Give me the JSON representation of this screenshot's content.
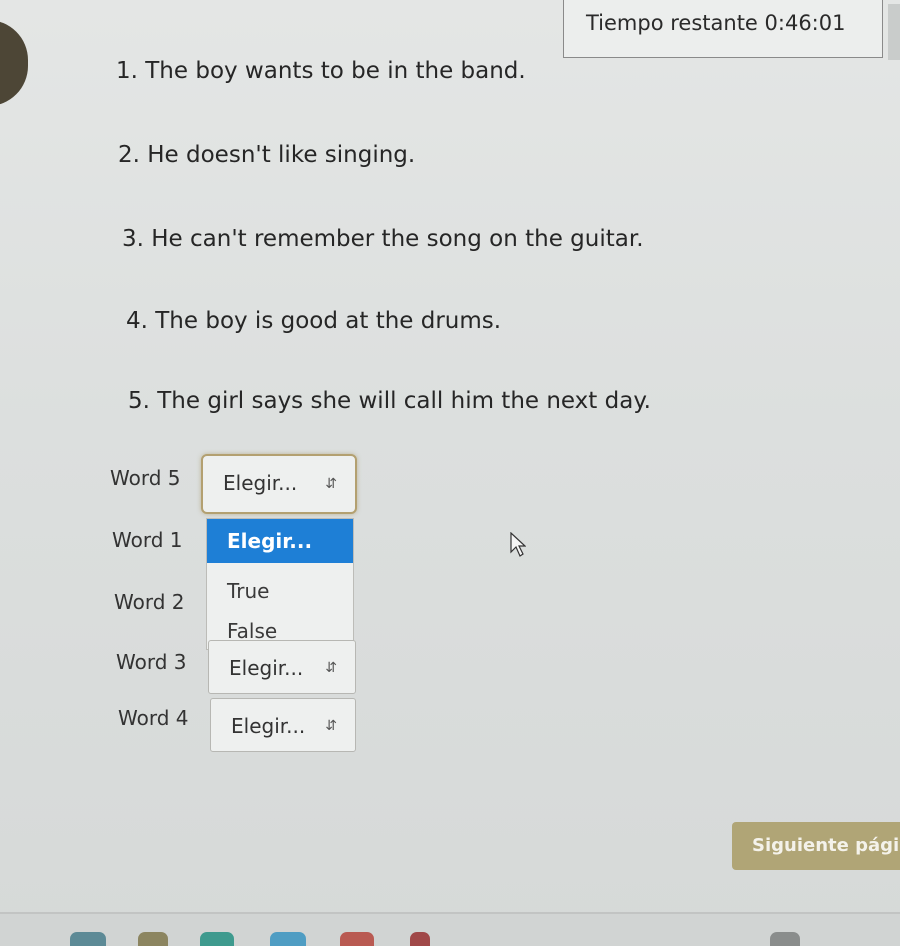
{
  "timer": {
    "label": "Tiempo restante 0:46:01"
  },
  "questions": [
    "1. The boy wants to be in the band.",
    "2. He doesn't like singing.",
    "3. He can't remember the song on the guitar.",
    "4. The boy is good at the drums.",
    "5. The girl says she will call him the next day."
  ],
  "answers": [
    {
      "label": "Word 5",
      "value": "Elegir..."
    },
    {
      "label": "Word 1",
      "value": "Elegir..."
    },
    {
      "label": "Word 2",
      "value": ""
    },
    {
      "label": "Word 3",
      "value": "Elegir..."
    },
    {
      "label": "Word 4",
      "value": "Elegir..."
    }
  ],
  "dropdown": {
    "options": [
      "Elegir...",
      "True",
      "False"
    ],
    "highlighted": "Elegir..."
  },
  "next_button": {
    "label": "Siguiente pági"
  },
  "colors": {
    "accent": "#1e7fd6",
    "button": "#b0a576",
    "focus_border": "#b3a070"
  }
}
